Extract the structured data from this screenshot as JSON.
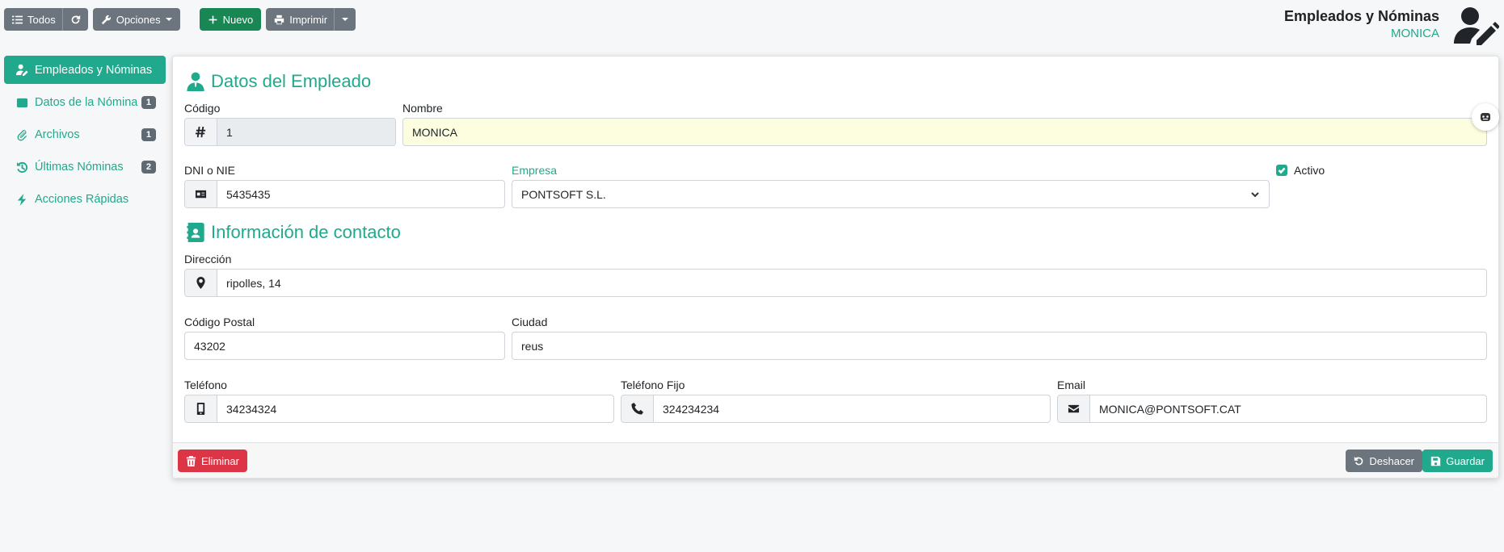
{
  "toolbar": {
    "todos_label": "Todos",
    "opciones_label": "Opciones",
    "nuevo_label": "Nuevo",
    "imprimir_label": "Imprimir"
  },
  "header": {
    "title": "Empleados y Nóminas",
    "user": "MONICA"
  },
  "sidebar": {
    "items": [
      {
        "label": "Empleados y Nóminas",
        "icon": "user-edit-icon",
        "badge": ""
      },
      {
        "label": "Datos de la Nómina",
        "icon": "table-icon",
        "badge": "1"
      },
      {
        "label": "Archivos",
        "icon": "paperclip-icon",
        "badge": "1"
      },
      {
        "label": "Últimas Nóminas",
        "icon": "history-icon",
        "badge": "2"
      },
      {
        "label": "Acciones Rápidas",
        "icon": "bolt-icon",
        "badge": ""
      }
    ]
  },
  "employee": {
    "section_title": "Datos del Empleado",
    "codigo_label": "Código",
    "codigo_value": "1",
    "nombre_label": "Nombre",
    "nombre_value": "MONICA",
    "dni_label": "DNI o NIE",
    "dni_value": "5435435",
    "empresa_label": "Empresa",
    "empresa_value": "PONTSOFT S.L.",
    "activo_label": "Activo",
    "activo_checked": true
  },
  "contact": {
    "section_title": "Información de contacto",
    "direccion_label": "Dirección",
    "direccion_value": "ripolles, 14",
    "cp_label": "Código Postal",
    "cp_value": "43202",
    "ciudad_label": "Ciudad",
    "ciudad_value": "reus",
    "telefono_label": "Teléfono",
    "telefono_value": "34234324",
    "telefono_fijo_label": "Teléfono Fijo",
    "telefono_fijo_value": "324234234",
    "email_label": "Email",
    "email_value": "MONICA@PONTSOFT.CAT"
  },
  "footer": {
    "eliminar_label": "Eliminar",
    "deshacer_label": "Deshacer",
    "guardar_label": "Guardar"
  },
  "colors": {
    "accent": "#20a98c",
    "danger": "#dc3545",
    "success": "#198754",
    "secondary": "#6c757d"
  }
}
